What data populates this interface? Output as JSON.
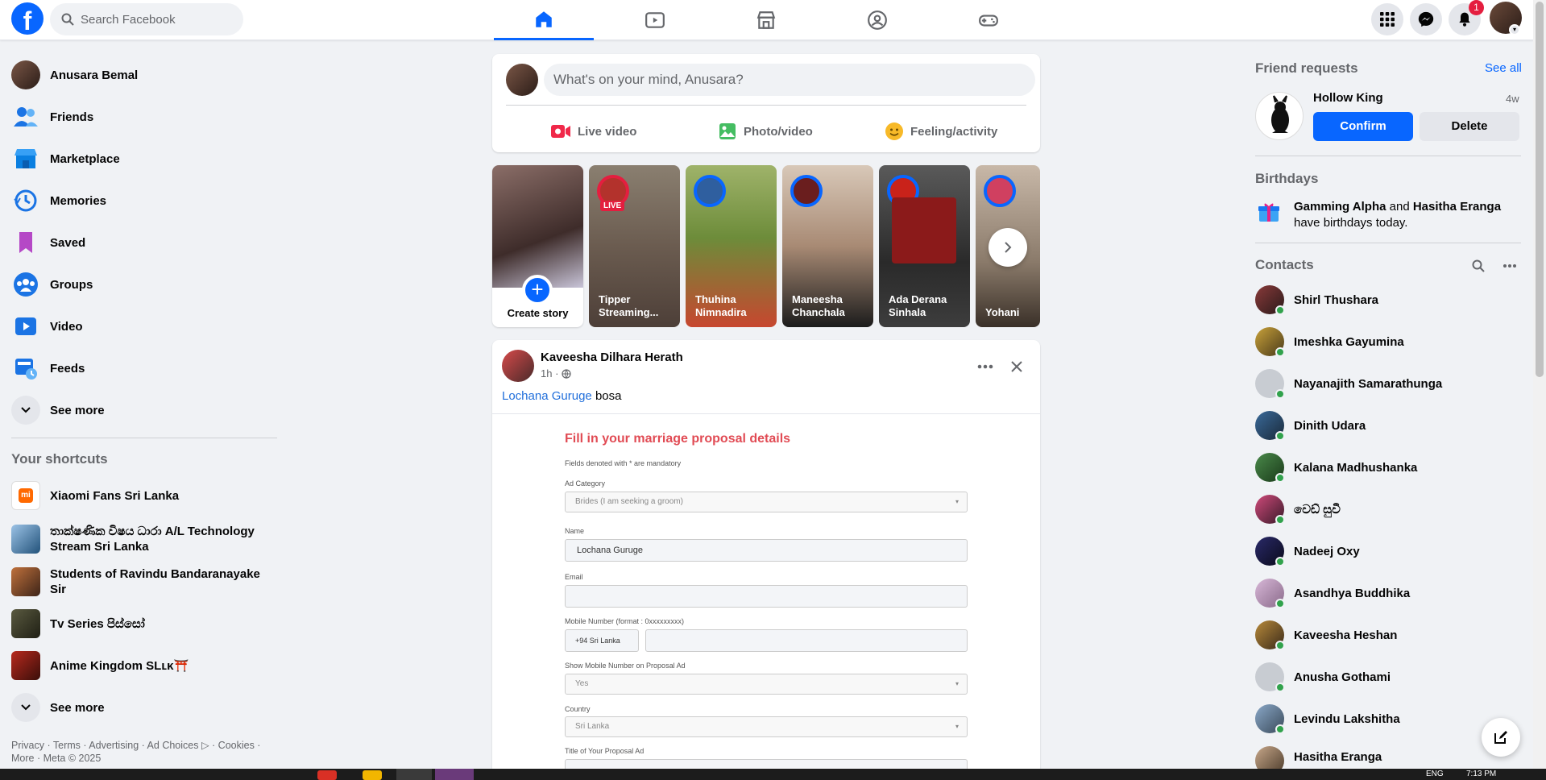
{
  "topbar": {
    "search_placeholder": "Search Facebook",
    "notification_count": "1"
  },
  "left": {
    "profile_name": "Anusara Bemal",
    "items": [
      {
        "label": "Friends",
        "icon": "friends-icon"
      },
      {
        "label": "Marketplace",
        "icon": "marketplace-icon"
      },
      {
        "label": "Memories",
        "icon": "memories-icon"
      },
      {
        "label": "Saved",
        "icon": "saved-icon"
      },
      {
        "label": "Groups",
        "icon": "groups-icon"
      },
      {
        "label": "Video",
        "icon": "video-icon"
      },
      {
        "label": "Feeds",
        "icon": "feeds-icon"
      }
    ],
    "see_more": "See more",
    "shortcuts_title": "Your shortcuts",
    "shortcuts": [
      {
        "label": "Xiaomi Fans Sri Lanka"
      },
      {
        "label": "තාක්ෂණික විෂය ධාරා A/L Technology Stream Sri Lanka"
      },
      {
        "label": "Students of Ravindu Bandaranayake Sir"
      },
      {
        "label": "Tv Series පිස්සෝ"
      },
      {
        "label": "Anime Kingdom SLʟᴋ⛩️"
      }
    ],
    "see_more_2": "See more",
    "footer_line1": "Privacy · Terms · Advertising · Ad Choices ▷ · Cookies ·",
    "footer_line2": "More · Meta © 2025"
  },
  "composer": {
    "placeholder": "What's on your mind, Anusara?",
    "live": "Live video",
    "photo": "Photo/video",
    "feeling": "Feeling/activity"
  },
  "stories": {
    "create": "Create story",
    "live_badge": "LIVE",
    "items": [
      {
        "name": "Tipper Streaming..."
      },
      {
        "name": "Thuhina Nimnadira"
      },
      {
        "name": "Maneesha Chanchala"
      },
      {
        "name": "Ada Derana Sinhala"
      },
      {
        "name": "Yohani"
      }
    ]
  },
  "post": {
    "author": "Kaveesha Dilhara Herath",
    "time": "1h ·",
    "tag": "Lochana Guruge",
    "text": "bosa",
    "form": {
      "title": "Fill in your marriage proposal details",
      "note": "Fields denoted with * are mandatory",
      "ad_category_label": "Ad Category",
      "ad_category_value": "Brides (I am seeking a groom)",
      "name_label": "Name",
      "name_value": "Lochana Guruge",
      "email_label": "Email",
      "mobile_label": "Mobile Number (format : 0xxxxxxxxx)",
      "country_code": "+94 Sri Lanka",
      "show_mobile_label": "Show Mobile Number on Proposal Ad",
      "show_mobile_value": "Yes",
      "country_label": "Country",
      "country_value": "Sri Lanka",
      "title_label": "Title of Your Proposal Ad"
    }
  },
  "right": {
    "friend_requests_title": "Friend requests",
    "see_all": "See all",
    "request_name": "Hollow King",
    "request_time": "4w",
    "confirm": "Confirm",
    "delete": "Delete",
    "birthdays_title": "Birthdays",
    "birthday_name1": "Gamming Alpha",
    "birthday_and": "and",
    "birthday_name2": "Hasitha Eranga",
    "birthday_suffix": "have birthdays today.",
    "contacts_title": "Contacts",
    "contacts": [
      {
        "name": "Shirl Thushara"
      },
      {
        "name": "Imeshka Gayumina"
      },
      {
        "name": "Nayanajith Samarathunga"
      },
      {
        "name": "Dinith Udara"
      },
      {
        "name": "Kalana Madhushanka"
      },
      {
        "name": "වෙඩ් සුවී"
      },
      {
        "name": "Nadeej Oxy"
      },
      {
        "name": "Asandhya Buddhika"
      },
      {
        "name": "Kaveesha Heshan"
      },
      {
        "name": "Anusha Gothami"
      },
      {
        "name": "Levindu Lakshitha"
      },
      {
        "name": "Hasitha Eranga"
      }
    ]
  },
  "taskbar": {
    "lang": "ENG",
    "time": "7:13 PM"
  }
}
